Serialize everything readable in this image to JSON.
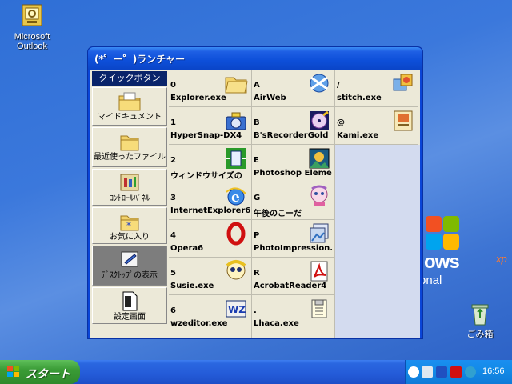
{
  "desktop": {
    "icons": [
      {
        "label_line1": "Microsoft",
        "label_line2": "Outlook"
      },
      {
        "label": "ごみ箱"
      }
    ],
    "wallpaper_logo": {
      "word": "ows",
      "xp": "xp",
      "sub": "onal"
    }
  },
  "window": {
    "title": "(*゜ー゜)ランチャー",
    "quick_header": "クイックボタン",
    "quick_items": [
      {
        "label": "マイドキュメント",
        "icon": "folder-documents-icon"
      },
      {
        "label": "最近使ったファイル",
        "icon": "folder-recent-icon"
      },
      {
        "label": "ｺﾝﾄﾛｰﾙﾊﾟﾈﾙ",
        "icon": "control-panel-icon"
      },
      {
        "label": "お気に入り",
        "icon": "favorites-icon"
      },
      {
        "label": "ﾃﾞｽｸﾄｯﾌﾟの表示",
        "icon": "show-desktop-icon",
        "selected": true
      },
      {
        "label": "設定画面",
        "icon": "settings-icon"
      }
    ],
    "grid": [
      [
        {
          "key": "0",
          "name": "Explorer.exe",
          "icon": "folder-icon"
        },
        {
          "key": "A",
          "name": "AirWeb",
          "icon": "airweb-icon"
        },
        {
          "key": "/",
          "name": "stitch.exe",
          "icon": "stitch-icon"
        }
      ],
      [
        {
          "key": "1",
          "name": "HyperSnap-DX4",
          "icon": "camera-icon"
        },
        {
          "key": "B",
          "name": "B'sRecorderGold",
          "icon": "cd-recorder-icon"
        },
        {
          "key": "@",
          "name": "Kami.exe",
          "icon": "kami-icon"
        }
      ],
      [
        {
          "key": "2",
          "name": "ウィンドウサイズの",
          "icon": "window-size-icon"
        },
        {
          "key": "E",
          "name": "Photoshop Eleme",
          "icon": "photoshop-icon"
        }
      ],
      [
        {
          "key": "3",
          "name": "InternetExplorer6",
          "icon": "ie-icon"
        },
        {
          "key": "G",
          "name": "午後のこーだ",
          "icon": "gogo-icon"
        }
      ],
      [
        {
          "key": "4",
          "name": "Opera6",
          "icon": "opera-icon"
        },
        {
          "key": "P",
          "name": "PhotoImpression.",
          "icon": "photoimpression-icon"
        }
      ],
      [
        {
          "key": "5",
          "name": "Susie.exe",
          "icon": "susie-icon"
        },
        {
          "key": "R",
          "name": "AcrobatReader4",
          "icon": "acrobat-icon"
        }
      ],
      [
        {
          "key": "6",
          "name": "wzeditor.exe",
          "icon": "wz-icon"
        },
        {
          "key": ".",
          "name": "Lhaca.exe",
          "icon": "lhaca-icon"
        }
      ]
    ]
  },
  "taskbar": {
    "start_label": "スタート",
    "clock": "16:56"
  }
}
